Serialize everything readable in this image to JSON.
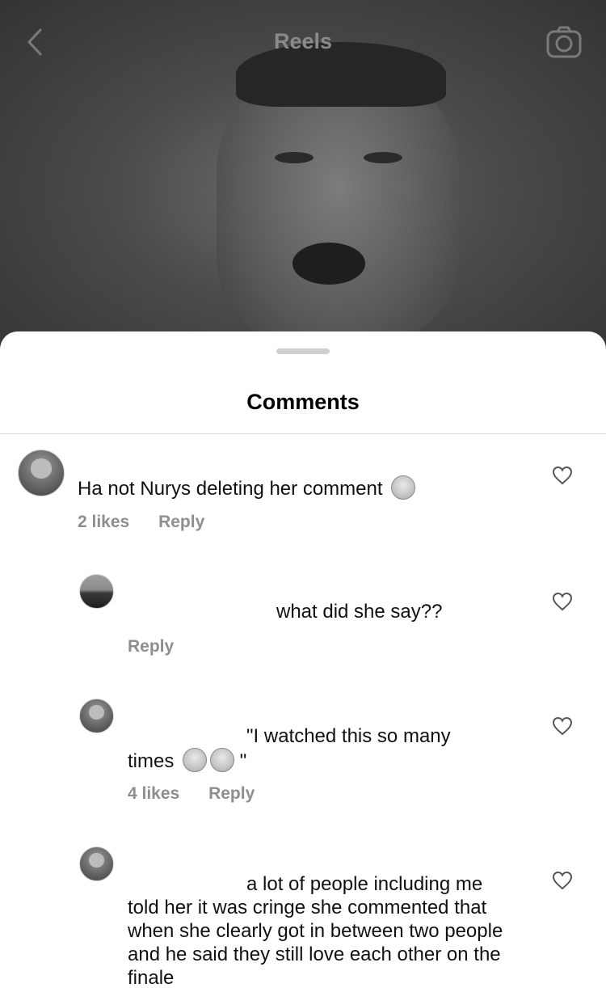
{
  "header": {
    "title": "Reels",
    "back_icon": "chevron-left-icon",
    "camera_icon": "camera-icon"
  },
  "sheet": {
    "title": "Comments"
  },
  "comments": [
    {
      "text": "Ha not Nurys deleting her comment",
      "emoji": [
        "laughing-tears-emoji"
      ],
      "likes": "2 likes",
      "reply": "Reply"
    },
    {
      "text": "what did she say??",
      "likes": "",
      "reply": "Reply"
    },
    {
      "text_line1": "\"I watched this so many",
      "text_line2_start": "times",
      "text_line2_end": "\"",
      "emoji": [
        "relieved-face-emoji",
        "kissing-wink-emoji"
      ],
      "likes": "4 likes",
      "reply": "Reply"
    },
    {
      "text_line1": "a lot of people including me",
      "text_rest": "told her it was cringe she commented that when she clearly got in between two people and he said they still love each other on the finale"
    }
  ]
}
